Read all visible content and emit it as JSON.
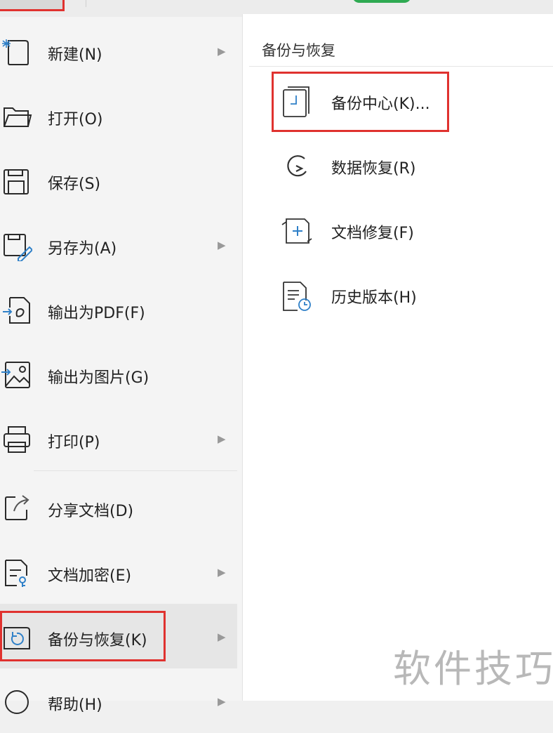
{
  "menu": {
    "items": [
      {
        "label": "新建(N)",
        "icon": "new-file-icon",
        "has_submenu": true
      },
      {
        "label": "打开(O)",
        "icon": "folder-open-icon",
        "has_submenu": false
      },
      {
        "label": "保存(S)",
        "icon": "save-icon",
        "has_submenu": false
      },
      {
        "label": "另存为(A)",
        "icon": "save-as-icon",
        "has_submenu": true
      },
      {
        "label": "输出为PDF(F)",
        "icon": "export-pdf-icon",
        "has_submenu": false
      },
      {
        "label": "输出为图片(G)",
        "icon": "export-image-icon",
        "has_submenu": false
      },
      {
        "label": "打印(P)",
        "icon": "print-icon",
        "has_submenu": true
      },
      {
        "label": "分享文档(D)",
        "icon": "share-icon",
        "has_submenu": false
      },
      {
        "label": "文档加密(E)",
        "icon": "encrypt-icon",
        "has_submenu": true
      },
      {
        "label": "备份与恢复(K)",
        "icon": "backup-restore-icon",
        "has_submenu": true,
        "active": true
      },
      {
        "label": "帮助(H)",
        "icon": "help-icon",
        "has_submenu": true
      }
    ],
    "arrow_glyph": "▶"
  },
  "submenu": {
    "title": "备份与恢复",
    "items": [
      {
        "label": "备份中心(K)...",
        "icon": "backup-center-icon",
        "highlighted": true
      },
      {
        "label": "数据恢复(R)",
        "icon": "data-recovery-icon"
      },
      {
        "label": "文档修复(F)",
        "icon": "document-repair-icon"
      },
      {
        "label": "历史版本(H)",
        "icon": "history-version-icon"
      }
    ]
  },
  "watermark": {
    "text": "软件技巧"
  },
  "colors": {
    "highlight": "#e0322f",
    "accent_blue": "#2f80c8",
    "green": "#2faa52"
  }
}
